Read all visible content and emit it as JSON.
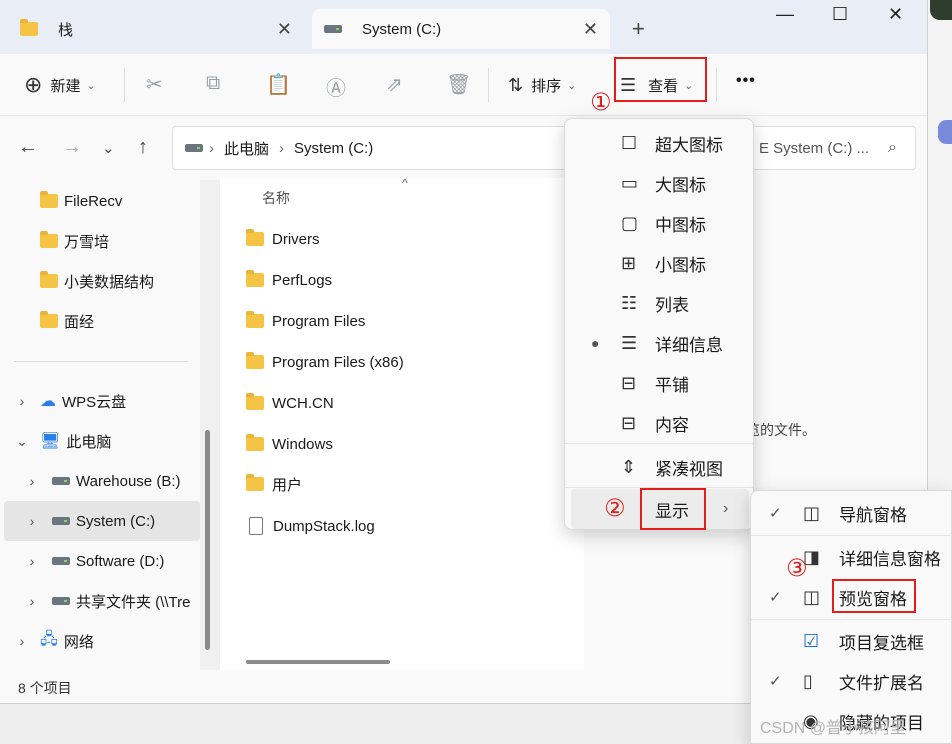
{
  "tabs": [
    {
      "label": "栈",
      "icon": "folder-icon",
      "close": "✕"
    },
    {
      "label": "System (C:)",
      "icon": "drive-icon",
      "close": "✕"
    }
  ],
  "new_tab_glyph": "+",
  "window_controls": {
    "minimize": "—",
    "maximize": "☐",
    "close": "✕"
  },
  "toolbar": {
    "new_label": "新建",
    "sort_label": "排序",
    "view_label": "查看",
    "more_label": "•••"
  },
  "annotations": {
    "one": "①",
    "two": "②",
    "three": "③",
    "accent": "#e01e1e"
  },
  "breadcrumb": {
    "this_pc": "此电脑",
    "drive": "System (C:)",
    "separator": "›"
  },
  "search": {
    "placeholder": "E System (C:) ..."
  },
  "sidebar": {
    "items": [
      {
        "label": "FileRecv",
        "type": "folder"
      },
      {
        "label": "万雪培",
        "type": "folder"
      },
      {
        "label": "小美数据结构",
        "type": "folder"
      },
      {
        "label": "面经",
        "type": "folder"
      },
      {
        "label": "WPS云盘",
        "type": "cloud"
      },
      {
        "label": "此电脑",
        "type": "pc"
      },
      {
        "label": "Warehouse (B:)",
        "type": "drive"
      },
      {
        "label": "System (C:)",
        "type": "drive",
        "selected": true
      },
      {
        "label": "Software (D:)",
        "type": "drive"
      },
      {
        "label": "共享文件夹 (\\\\Tre",
        "type": "netdrive"
      },
      {
        "label": "网络",
        "type": "network"
      }
    ]
  },
  "columns": {
    "name": "名称"
  },
  "files": [
    {
      "name": "Drivers",
      "type": "folder"
    },
    {
      "name": "PerfLogs",
      "type": "folder"
    },
    {
      "name": "Program Files",
      "type": "folder"
    },
    {
      "name": "Program Files (x86)",
      "type": "folder"
    },
    {
      "name": "WCH.CN",
      "type": "folder"
    },
    {
      "name": "Windows",
      "type": "folder"
    },
    {
      "name": "用户",
      "type": "folder"
    },
    {
      "name": "DumpStack.log",
      "type": "file"
    }
  ],
  "preview_text": "览的文件。",
  "status": {
    "count": "8 个项目"
  },
  "view_menu": {
    "items": [
      {
        "label": "超大图标",
        "icon": "extra-large-icons-icon"
      },
      {
        "label": "大图标",
        "icon": "large-icons-icon"
      },
      {
        "label": "中图标",
        "icon": "medium-icons-icon"
      },
      {
        "label": "小图标",
        "icon": "small-icons-icon"
      },
      {
        "label": "列表",
        "icon": "list-icon"
      },
      {
        "label": "详细信息",
        "icon": "details-icon",
        "selected": true
      },
      {
        "label": "平铺",
        "icon": "tiles-icon"
      },
      {
        "label": "内容",
        "icon": "content-icon"
      },
      {
        "label": "紧凑视图",
        "icon": "compact-view-icon"
      },
      {
        "label": "显示",
        "icon": "",
        "submenu": true
      }
    ]
  },
  "show_submenu": {
    "items": [
      {
        "label": "导航窗格",
        "checked": true
      },
      {
        "label": "详细信息窗格",
        "checked": false
      },
      {
        "label": "预览窗格",
        "checked": true
      },
      {
        "label": "项目复选框",
        "checked": false
      },
      {
        "label": "文件扩展名",
        "checked": true
      },
      {
        "label": "隐藏的项目",
        "checked": false
      }
    ]
  },
  "watermark": "CSDN @普小孩阿里"
}
